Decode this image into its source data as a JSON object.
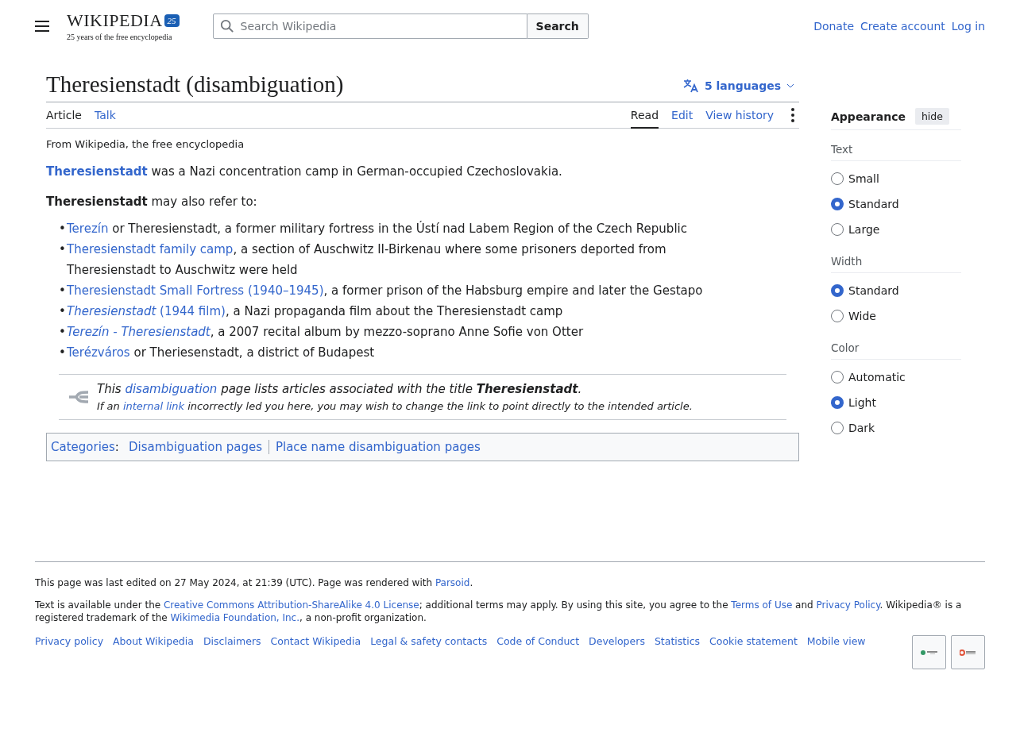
{
  "header": {
    "logo_text": "WIKIPEDIA",
    "logo_badge": "25",
    "tagline": "25 years of the free encyclopedia",
    "search": {
      "placeholder": "Search Wikipedia",
      "button": "Search"
    },
    "links": [
      "Donate",
      "Create account",
      "Log in"
    ]
  },
  "article": {
    "title": "Theresienstadt (disambiguation)",
    "languages": "5 languages",
    "tabs_left": [
      {
        "label": "Article",
        "selected": true
      },
      {
        "label": "Talk",
        "selected": false
      }
    ],
    "tabs_right": [
      {
        "label": "Read",
        "selected": true
      },
      {
        "label": "Edit",
        "selected": false
      },
      {
        "label": "View history",
        "selected": false
      }
    ],
    "tagline": "From Wikipedia, the free encyclopedia",
    "lead": [
      {
        "kind": "link",
        "text": "**Theresienstadt**"
      },
      {
        "kind": "text",
        "text": " was a Nazi concentration camp in German-occupied Czechoslovakia."
      }
    ],
    "intro": "**Theresienstadt** may also refer to:",
    "items": [
      {
        "marker": "•",
        "parts": [
          {
            "kind": "link",
            "text": "Terezín"
          },
          {
            "kind": "text",
            "text": " or Theresienstadt, a former military fortress in the Ústí nad Labem Region of the Czech Republic"
          }
        ]
      },
      {
        "marker": "•",
        "parts": [
          {
            "kind": "link",
            "text": "Theresienstadt family camp"
          },
          {
            "kind": "text",
            "text": ", a section of Auschwitz II-Birkenau where some prisoners deported from Theresienstadt to Auschwitz were held"
          }
        ]
      },
      {
        "marker": "•",
        "parts": [
          {
            "kind": "link",
            "text": "Theresienstadt Small Fortress (1940–1945)"
          },
          {
            "kind": "text",
            "text": ", a former prison of the Habsburg empire and later the Gestapo"
          }
        ]
      },
      {
        "marker": "•",
        "parts": [
          {
            "kind": "link",
            "text": "*Theresienstadt* (1944 film)"
          },
          {
            "kind": "text",
            "text": ", a Nazi propaganda film about the Theresienstadt camp"
          }
        ]
      },
      {
        "marker": "•",
        "parts": [
          {
            "kind": "link",
            "text": "Terezín - Theresienstadt",
            "italic": true
          },
          {
            "kind": "text",
            "text": ", a 2007 recital album by mezzo-soprano Anne Sofie von Otter"
          }
        ]
      },
      {
        "marker": "•",
        "parts": [
          {
            "kind": "link",
            "text": "Terézváros"
          },
          {
            "kind": "text",
            "text": " or Theriesenstadt, a district of Budapest"
          }
        ]
      }
    ],
    "hatnote": [
      [
        {
          "kind": "text",
          "text": "This "
        },
        {
          "kind": "link",
          "text": "disambiguation"
        },
        {
          "kind": "text",
          "text": " page lists articles associated with the title **Theresienstadt**."
        }
      ],
      [
        {
          "kind": "text",
          "text": "If an "
        },
        {
          "kind": "link",
          "text": "internal link"
        },
        {
          "kind": "text",
          "text": " incorrectly led you here, you may wish to change the link to point directly to the intended article."
        }
      ]
    ],
    "categories": {
      "label": "Categories",
      "separator": ":",
      "items": [
        "Disambiguation pages",
        "Place name disambiguation pages"
      ]
    }
  },
  "appearance": {
    "title": "Appearance",
    "hide": "hide",
    "groups": [
      {
        "label": "Text",
        "options": [
          {
            "label": "Small",
            "selected": false
          },
          {
            "label": "Standard",
            "selected": true
          },
          {
            "label": "Large",
            "selected": false
          }
        ]
      },
      {
        "label": "Width",
        "options": [
          {
            "label": "Standard",
            "selected": true
          },
          {
            "label": "Wide",
            "selected": false
          }
        ]
      },
      {
        "label": "Color",
        "options": [
          {
            "label": "Automatic",
            "selected": false
          },
          {
            "label": "Light",
            "selected": true
          },
          {
            "label": "Dark",
            "selected": false
          }
        ]
      }
    ]
  },
  "footer": {
    "edited": [
      {
        "kind": "text",
        "text": "This page was last edited on 27 May 2024, at 21:39 (UTC). Page was rendered with "
      },
      {
        "kind": "link",
        "text": "Parsoid"
      },
      {
        "kind": "text",
        "text": "."
      }
    ],
    "license": [
      {
        "kind": "text",
        "text": "Text is available under the "
      },
      {
        "kind": "link",
        "text": "Creative Commons Attribution-ShareAlike 4.0 License"
      },
      {
        "kind": "text",
        "text": "; additional terms may apply. By using this site, you agree to the "
      },
      {
        "kind": "link",
        "text": "Terms of Use"
      },
      {
        "kind": "text",
        "text": " and "
      },
      {
        "kind": "link",
        "text": "Privacy Policy"
      },
      {
        "kind": "text",
        "text": ". Wikipedia® is a registered trademark of the "
      },
      {
        "kind": "link",
        "text": "Wikimedia Foundation, Inc."
      },
      {
        "kind": "text",
        "text": ", a non-profit organization."
      }
    ],
    "links": [
      "Privacy policy",
      "About Wikipedia",
      "Disclaimers",
      "Contact Wikipedia",
      "Legal & safety contacts",
      "Code of Conduct",
      "Developers",
      "Statistics",
      "Cookie statement",
      "Mobile view"
    ]
  }
}
